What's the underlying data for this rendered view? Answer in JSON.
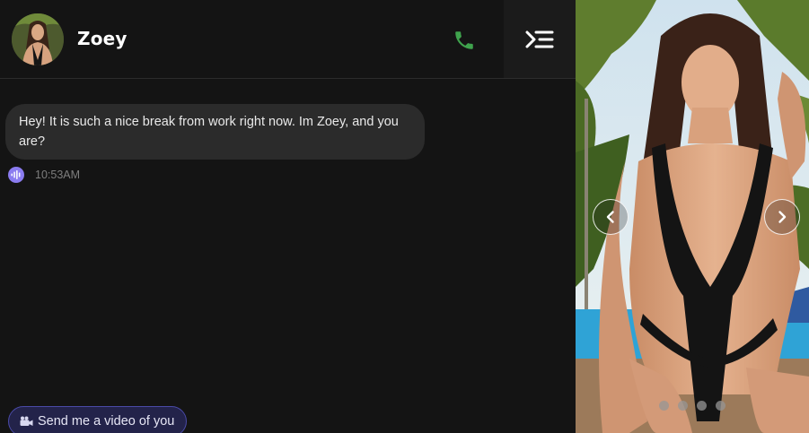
{
  "header": {
    "contact_name": "Zoey",
    "call_icon": "phone-icon",
    "menu_icon": "menu-collapse-icon",
    "call_color": "#3fa34d"
  },
  "messages": [
    {
      "text": "Hey! It is such a nice break from work right now. Im Zoey, and you are?",
      "time": "10:53AM",
      "audio_icon": "voice-wave-icon"
    }
  ],
  "suggestion": {
    "label": "Send me a video of you",
    "icon": "video-camera-icon"
  },
  "gallery": {
    "prev_icon": "chevron-left-icon",
    "next_icon": "chevron-right-icon",
    "dots": 4
  },
  "colors": {
    "background": "#141414",
    "bubble": "#2b2b2b",
    "accent_purple": "#8b7cf0",
    "suggestion_border": "#4a4aa8"
  }
}
